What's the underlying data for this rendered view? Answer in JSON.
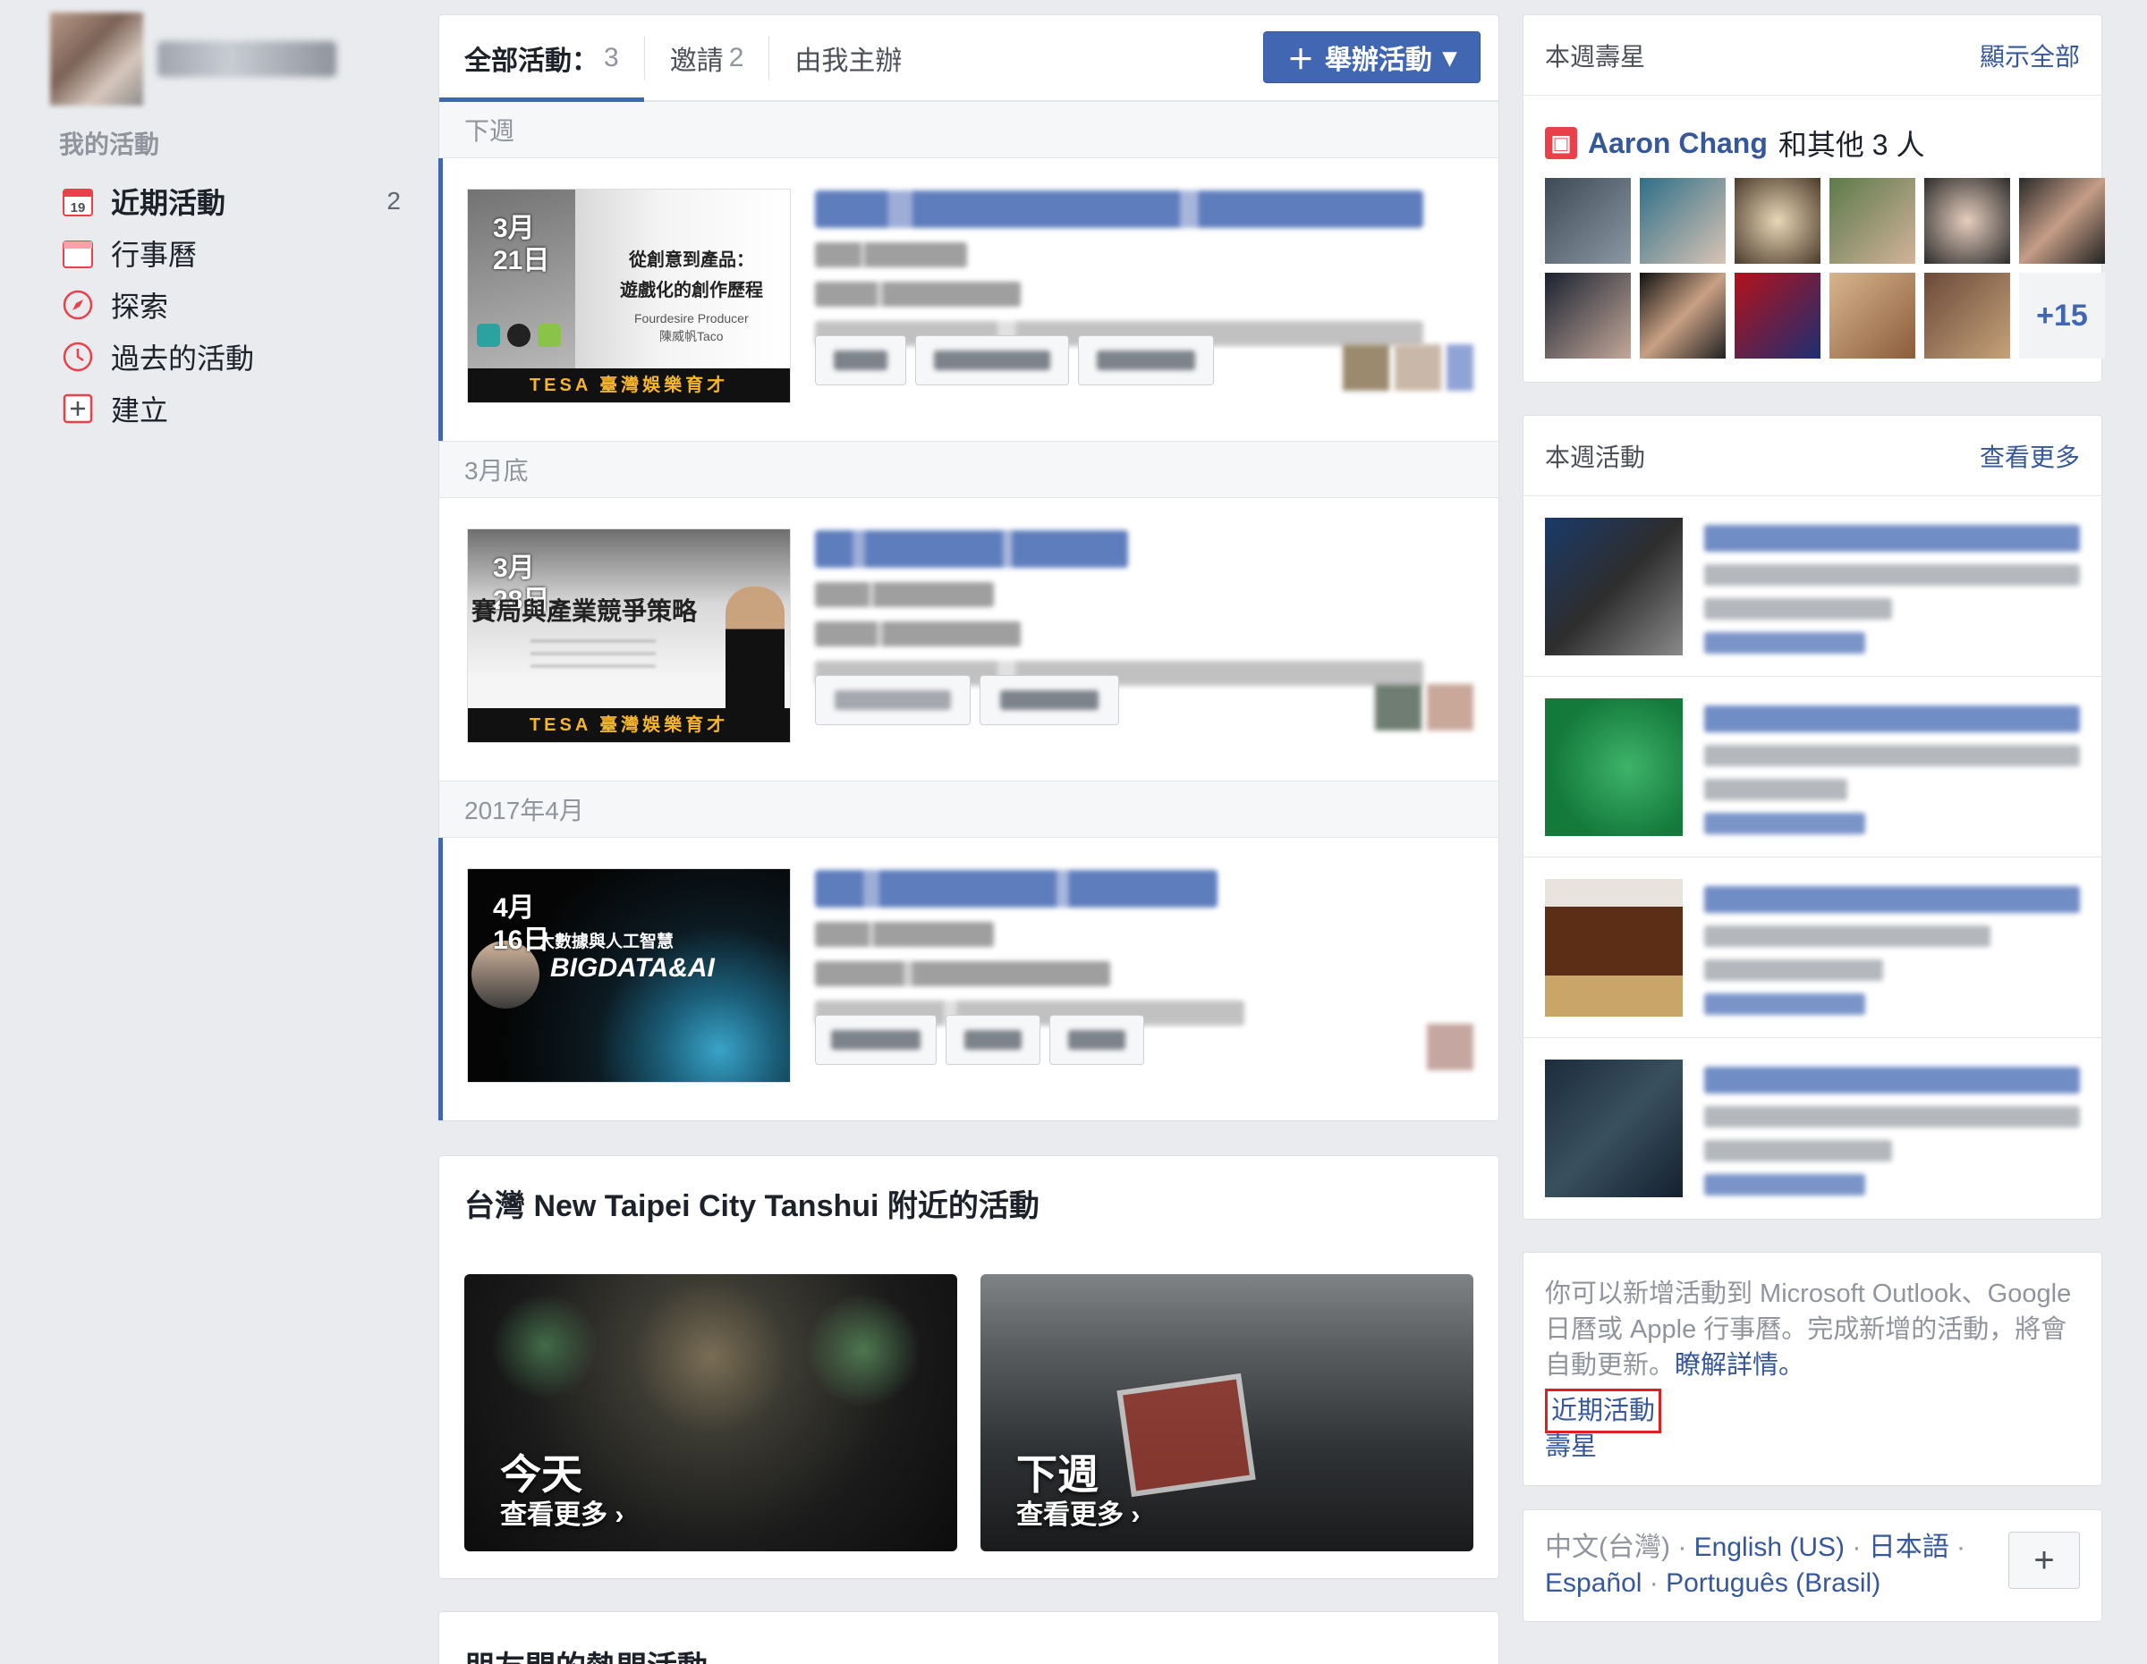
{
  "sidebar": {
    "section_title": "我的活動",
    "items": [
      {
        "label": "近期活動",
        "count": "2",
        "icon": "calendar-19-icon"
      },
      {
        "label": "行事曆",
        "count": "",
        "icon": "calendar-icon"
      },
      {
        "label": "探索",
        "count": "",
        "icon": "compass-icon"
      },
      {
        "label": "過去的活動",
        "count": "",
        "icon": "clock-icon"
      },
      {
        "label": "建立",
        "count": "",
        "icon": "plus-square-icon"
      }
    ]
  },
  "tabs": [
    {
      "label": "全部活動：",
      "count": "3"
    },
    {
      "label": "邀請",
      "count": "2"
    },
    {
      "label": "由我主辦",
      "count": ""
    }
  ],
  "create_button": {
    "label": "舉辦活動"
  },
  "event_groups": [
    {
      "label": "下週",
      "thumb_date": "3月\n21日",
      "thumb_title": "從創意到產品：\n遊戲化的創作歷程",
      "thumb_sub": "Fourdesire Producer\n陳威帆Taco",
      "banner": "TESA 臺灣娛樂育才"
    },
    {
      "label": "3月底",
      "thumb_date": "3月\n28日",
      "thumb_title": "賽局與產業競爭策略",
      "thumb_sub": "",
      "banner": "TESA 臺灣娛樂育才"
    },
    {
      "label": "2017年4月",
      "thumb_date": "4月\n16日",
      "thumb_title": "大數據與人工智慧",
      "thumb_sub": "BIGDATA&AI",
      "banner": ""
    }
  ],
  "nearby": {
    "title": "台灣 New Taipei City Tanshui 附近的活動",
    "tiles": [
      {
        "label": "今天",
        "link": "查看更多 ›"
      },
      {
        "label": "下週",
        "link": "查看更多 ›"
      }
    ]
  },
  "friends_section": {
    "title": "朋友間的熱門活動"
  },
  "birthdays": {
    "title": "本週壽星",
    "more": "顯示全部",
    "name": "Aaron Chang",
    "suffix": "和其他 3 人",
    "more_count": "+15"
  },
  "week_events": {
    "title": "本週活動",
    "more": "查看更多"
  },
  "calendar_info": {
    "text": "你可以新增活動到 Microsoft Outlook、Google 日曆或 Apple 行事曆。完成新增的活動，將會自動更新。",
    "learn_more": "瞭解詳情。",
    "link_upcoming": "近期活動",
    "link_birthdays": "壽星"
  },
  "languages": {
    "current": "中文(台灣)",
    "others": [
      "English (US)",
      "日本語",
      "Español",
      "Português (Brasil)"
    ]
  },
  "colors": {
    "accent": "#4267b2",
    "link": "#365899",
    "highlight_box": "#e02020"
  }
}
